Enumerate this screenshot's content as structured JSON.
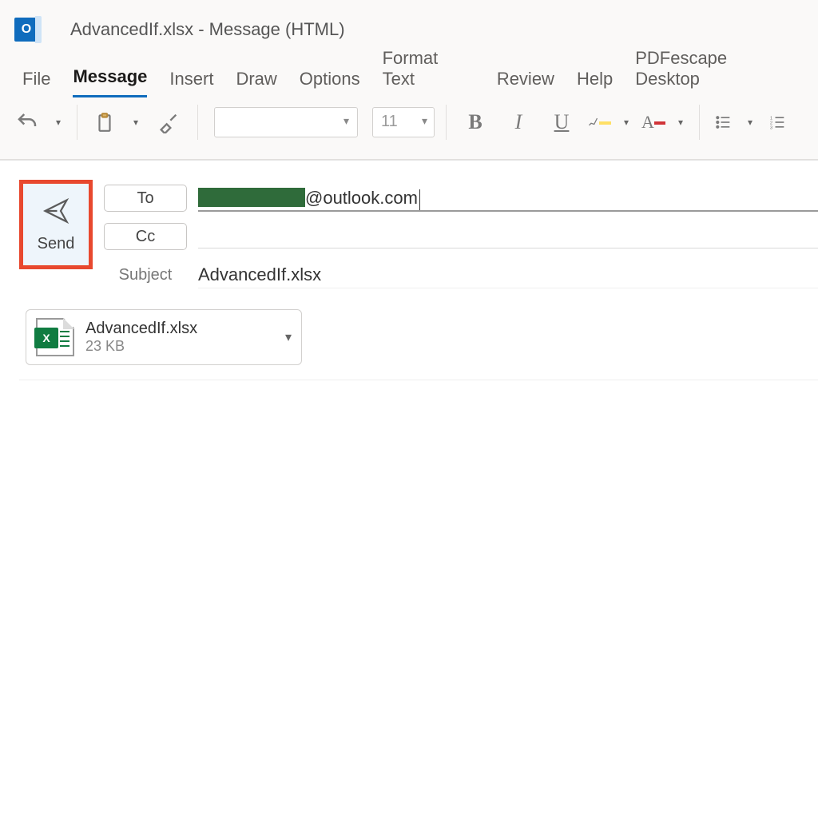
{
  "window": {
    "title": "AdvancedIf.xlsx  -  Message (HTML)"
  },
  "tabs": {
    "file": "File",
    "message": "Message",
    "insert": "Insert",
    "draw": "Draw",
    "options": "Options",
    "formatText": "Format Text",
    "review": "Review",
    "help": "Help",
    "pdf": "PDFescape Desktop"
  },
  "ribbon": {
    "fontSize": "11",
    "bold": "B",
    "italic": "I",
    "underline": "U",
    "fontGlyph": "A"
  },
  "compose": {
    "sendLabel": "Send",
    "toLabel": "To",
    "ccLabel": "Cc",
    "subjectLabel": "Subject",
    "toVisible": "@outlook.com",
    "subjectValue": "AdvancedIf.xlsx"
  },
  "attachment": {
    "name": "AdvancedIf.xlsx",
    "size": "23 KB",
    "badge": "X"
  }
}
